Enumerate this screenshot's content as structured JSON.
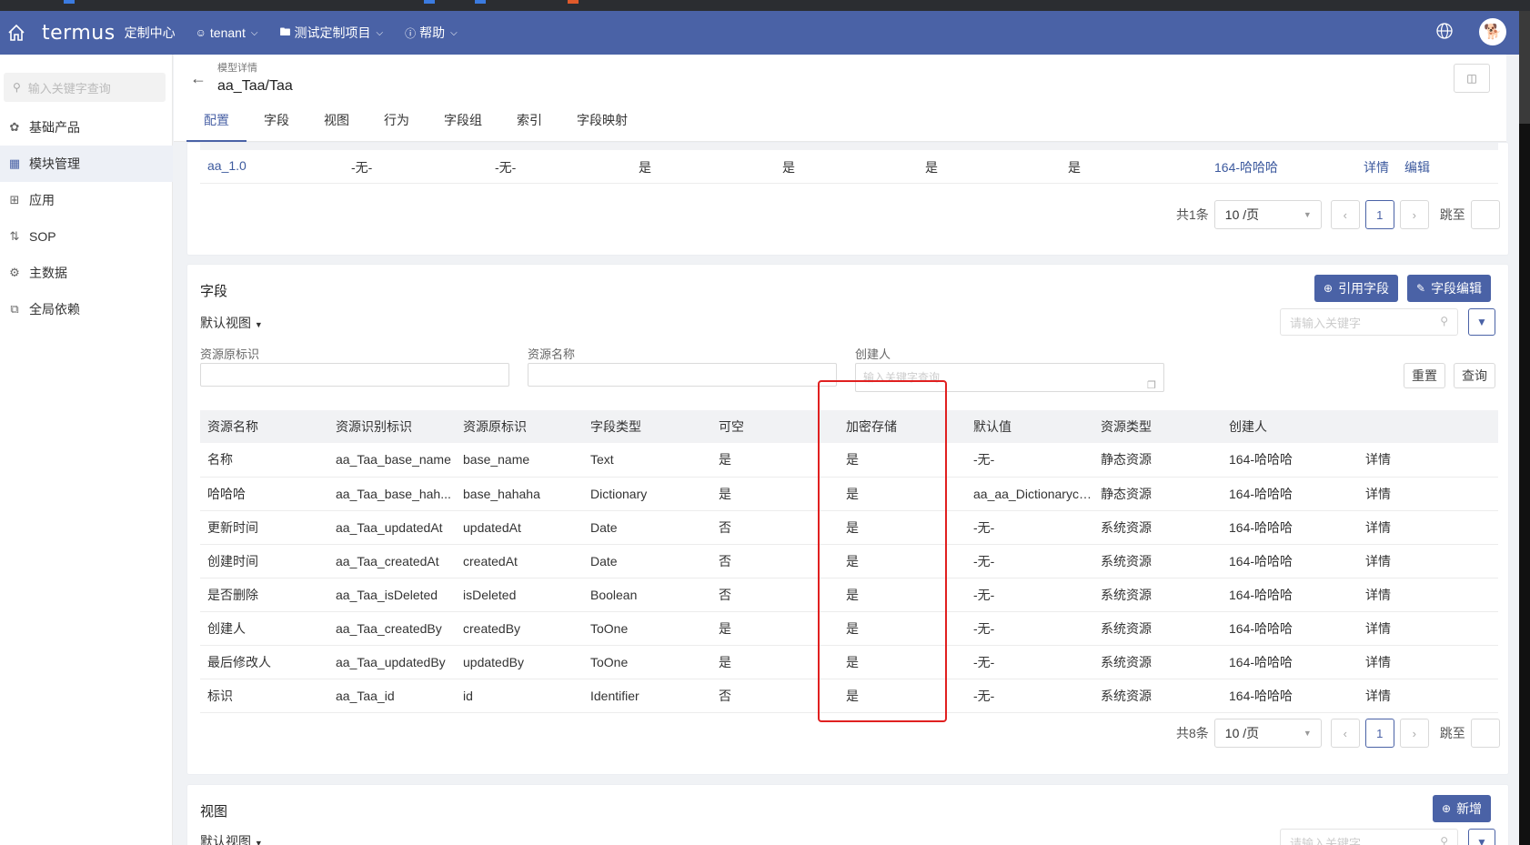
{
  "header": {
    "logo": "termus",
    "center_name": "定制中心",
    "menus": [
      {
        "label": "tenant"
      },
      {
        "label": "测试定制项目"
      },
      {
        "label": "帮助"
      }
    ],
    "avatar_glyph": "🐕"
  },
  "sidebar": {
    "search_placeholder": "输入关键字查询",
    "items": [
      {
        "label": "基础产品",
        "icon": "cluster-icon"
      },
      {
        "label": "模块管理",
        "icon": "module-icon"
      },
      {
        "label": "应用",
        "icon": "app-grid-icon"
      },
      {
        "label": "SOP",
        "icon": "flow-icon"
      },
      {
        "label": "主数据",
        "icon": "data-icon"
      },
      {
        "label": "全局依赖",
        "icon": "dependency-icon"
      }
    ]
  },
  "page": {
    "subtitle": "模型详情",
    "title": "aa_Taa/Taa",
    "tabs": [
      "配置",
      "字段",
      "视图",
      "行为",
      "字段组",
      "索引",
      "字段映射"
    ]
  },
  "top_table": {
    "row": {
      "name": "aa_1.0",
      "c2": "-无-",
      "c3": "-无-",
      "c4": "是",
      "c5": "是",
      "c6": "是",
      "c7": "是",
      "creator": "164-哈哈哈",
      "detail": "详情",
      "edit": "编辑"
    },
    "pager": {
      "total": "共1条",
      "size": "10 /页",
      "page": "1",
      "jump": "跳至"
    }
  },
  "fields": {
    "title": "字段",
    "view_dropdown": "默认视图",
    "ref_button": "引用字段",
    "edit_button": "字段编辑",
    "keyword_placeholder": "请输入关键字",
    "filters": {
      "source_id_label": "资源原标识",
      "source_name_label": "资源名称",
      "creator_label": "创建人",
      "creator_placeholder": "输入关键字查询",
      "reset": "重置",
      "query": "查询"
    },
    "columns": [
      "资源名称",
      "资源识别标识",
      "资源原标识",
      "字段类型",
      "可空",
      "加密存储",
      "默认值",
      "资源类型",
      "创建人",
      ""
    ],
    "rows": [
      [
        "名称",
        "aa_Taa_base_name",
        "base_name",
        "Text",
        "是",
        "是",
        "-无-",
        "静态资源",
        "164-哈哈哈",
        "详情"
      ],
      [
        "哈哈哈",
        "aa_Taa_base_hah...",
        "base_hahaha",
        "Dictionary",
        "是",
        "是",
        "aa_aa_Dictionarycurr",
        "静态资源",
        "164-哈哈哈",
        "详情"
      ],
      [
        "更新时间",
        "aa_Taa_updatedAt",
        "updatedAt",
        "Date",
        "否",
        "是",
        "-无-",
        "系统资源",
        "164-哈哈哈",
        "详情"
      ],
      [
        "创建时间",
        "aa_Taa_createdAt",
        "createdAt",
        "Date",
        "否",
        "是",
        "-无-",
        "系统资源",
        "164-哈哈哈",
        "详情"
      ],
      [
        "是否删除",
        "aa_Taa_isDeleted",
        "isDeleted",
        "Boolean",
        "否",
        "是",
        "-无-",
        "系统资源",
        "164-哈哈哈",
        "详情"
      ],
      [
        "创建人",
        "aa_Taa_createdBy",
        "createdBy",
        "ToOne",
        "是",
        "是",
        "-无-",
        "系统资源",
        "164-哈哈哈",
        "详情"
      ],
      [
        "最后修改人",
        "aa_Taa_updatedBy",
        "updatedBy",
        "ToOne",
        "是",
        "是",
        "-无-",
        "系统资源",
        "164-哈哈哈",
        "详情"
      ],
      [
        "标识",
        "aa_Taa_id",
        "id",
        "Identifier",
        "否",
        "是",
        "-无-",
        "系统资源",
        "164-哈哈哈",
        "详情"
      ]
    ],
    "pager": {
      "total": "共8条",
      "size": "10 /页",
      "page": "1",
      "jump": "跳至"
    }
  },
  "views": {
    "title": "视图",
    "add_button": "新增",
    "view_dropdown": "默认视图",
    "keyword_placeholder": "请输入关键字"
  },
  "colors": {
    "primary": "#4a62a6",
    "link": "#3d5a9e",
    "highlight": "#e02020"
  }
}
